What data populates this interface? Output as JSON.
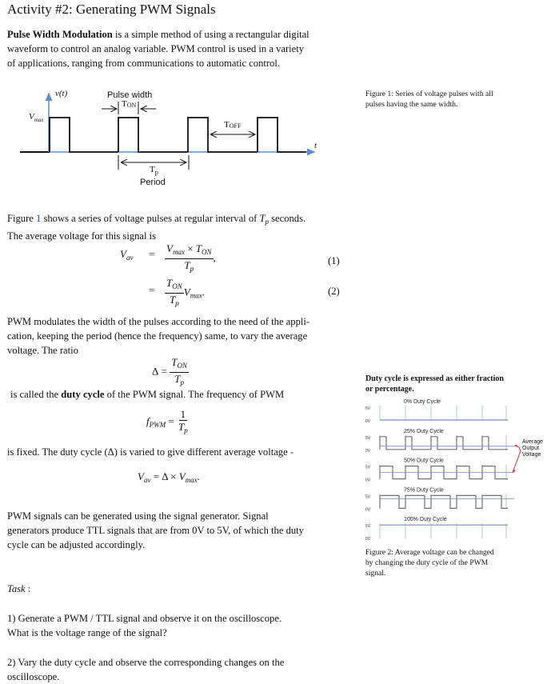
{
  "title": "Activity #2: Generating PWM Signals",
  "intro": {
    "bold": "Pulse Width Modulation",
    "rest_line1": " is a simple method of using a rectangular digital",
    "line2": "waveform to control an analog variable. PWM control is used in a variety",
    "line3": "of applications, ranging from communications to automatic control."
  },
  "figure1": {
    "y_label": "v(t)",
    "vmax_label": "V",
    "vmax_sub": "max",
    "pulse_width_label": "Pulse width",
    "ton_label": "T",
    "ton_sub": "ON",
    "toff_label": "T",
    "toff_sub": "OFF",
    "tp_label": "T",
    "tp_sub": "p",
    "period_label": "Period",
    "t_label": "t",
    "caption_line1": "Figure 1: Series of voltage pulses with all",
    "caption_line2": "pulses having the same width."
  },
  "para2": {
    "line1_a": "Figure ",
    "line1_ref": "1",
    "line1_b": " shows a series of voltage pulses at regular interval of ",
    "line1_var": "T",
    "line1_var_sub": "p",
    "line1_c": " seconds.",
    "line2": "The average voltage for this signal is"
  },
  "eq1": {
    "lhs": "V",
    "lhs_sub": "av",
    "equals": "=",
    "num_a": "V",
    "num_a_sub": "max",
    "times": " × ",
    "num_b": "T",
    "num_b_sub": "ON",
    "den": "T",
    "den_sub": "p",
    "trail": ",",
    "number": "(1)"
  },
  "eq2": {
    "equals": "=",
    "num": "T",
    "num_sub": "ON",
    "den": "T",
    "den_sub": "p",
    "tail": "V",
    "tail_sub": "max",
    "trail": ".",
    "number": "(2)"
  },
  "para3": {
    "line1": "PWM modulates the width of the pulses according to the need of the appli-",
    "line2": "cation, keeping the period (hence the frequency) same, to vary the average",
    "line3": "voltage. The ratio"
  },
  "eq_delta": {
    "lhs": "Δ",
    "equals": "=",
    "num": "T",
    "num_sub": "ON",
    "den": "T",
    "den_sub": "p"
  },
  "para4": {
    "a": "is called the ",
    "bold": "duty cycle",
    "b": " of the PWM signal. The frequency of PWM"
  },
  "eq_freq": {
    "lhs": "f",
    "lhs_sub": "PWM",
    "equals": "=",
    "num": "1",
    "den": "T",
    "den_sub": "p"
  },
  "para5": {
    "line1": "is fixed. The duty cycle (Δ) is varied to give different average voltage -"
  },
  "eq_vav": {
    "lhs": "V",
    "lhs_sub": "av",
    "mid": " = Δ × ",
    "rhs": "V",
    "rhs_sub": "max",
    "trail": "."
  },
  "para6": {
    "line1": "PWM signals can be generated using the signal generator. Signal",
    "line2": "generators produce TTL signals that are from 0V to 5V, of which the duty",
    "line3": "cycle can be adjusted accordingly."
  },
  "task": {
    "heading": "Task",
    "colon": " :",
    "item1_line1": "1) Generate a PWM / TTL signal and observe it on the oscilloscope.",
    "item1_line2": "What is the voltage range of the signal?",
    "item2_line1": "2) Vary the duty cycle and observe the corresponding changes on the",
    "item2_line2": "oscilloscope."
  },
  "figure2": {
    "heading_line1": "Duty cycle is expressed as either fraction",
    "heading_line2": "or percentage.",
    "v_high": "5V",
    "v_low": "0V",
    "avg_label": [
      "Average",
      "Output",
      "Voltage"
    ],
    "caption_line1": "Figure 2: Average voltage can be changed",
    "caption_line2": "by changing the duty cycle of the PWM",
    "caption_line3": "signal.",
    "colors": {
      "signal": "#707070",
      "average": "#7b86c8",
      "grid": "#a8d4b0",
      "arrow": "#e03030",
      "axis": "#5b8fd0"
    },
    "rows": [
      {
        "label": "0% Duty Cycle",
        "duty": 0
      },
      {
        "label": "25% Duty Cycle",
        "duty": 0.25
      },
      {
        "label": "50% Duty Cycle",
        "duty": 0.5
      },
      {
        "label": "75% Duty Cycle",
        "duty": 0.75
      },
      {
        "label": "100% Duty Cycle",
        "duty": 1
      }
    ]
  }
}
